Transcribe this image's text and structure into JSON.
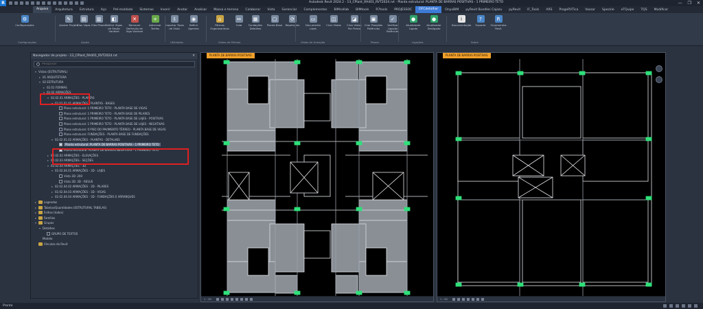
{
  "app": {
    "logo": "R",
    "title": "Autodesk Revit 2024.2 - 13_CPlant_RA401_RVT2024.rvt - Planta estrutural: PLANTA DE BARRAS POSITIVAS - 1 PRIMEIRO TETO"
  },
  "window_controls": [
    "—",
    "❐",
    "✕"
  ],
  "tabs": [
    {
      "label": "Arquivo",
      "state": "active"
    },
    {
      "label": "Arquitetura",
      "state": ""
    },
    {
      "label": "Estrutura",
      "state": ""
    },
    {
      "label": "Aço",
      "state": ""
    },
    {
      "label": "Pré-moldado",
      "state": ""
    },
    {
      "label": "Sistemas",
      "state": ""
    },
    {
      "label": "Inserir",
      "state": ""
    },
    {
      "label": "Anotar",
      "state": ""
    },
    {
      "label": "Analisar",
      "state": ""
    },
    {
      "label": "Massa e terreno",
      "state": ""
    },
    {
      "label": "Colaborar",
      "state": ""
    },
    {
      "label": "Vista",
      "state": ""
    },
    {
      "label": "Gerenciar",
      "state": ""
    },
    {
      "label": "Complementos",
      "state": ""
    },
    {
      "label": "BIMcollab",
      "state": ""
    },
    {
      "label": "BIMtools",
      "state": ""
    },
    {
      "label": "R7tools",
      "state": ""
    },
    {
      "label": "PROJESSOC",
      "state": ""
    },
    {
      "label": "OFCdetalhar",
      "state": "hl"
    },
    {
      "label": "OnyxBIM",
      "state": ""
    },
    {
      "label": "pyRevit Bundles Cajazu",
      "state": ""
    },
    {
      "label": "pyRevit",
      "state": ""
    },
    {
      "label": "IF_Tools",
      "state": ""
    },
    {
      "label": "ARS",
      "state": ""
    },
    {
      "label": "ProgeRVTica",
      "state": ""
    },
    {
      "label": "Vassar",
      "state": ""
    },
    {
      "label": "Speckle",
      "state": ""
    },
    {
      "label": "eTQuipe",
      "state": ""
    },
    {
      "label": "TQS",
      "state": ""
    },
    {
      "label": "Modificar",
      "state": ""
    }
  ],
  "ribbon": {
    "buttons": [
      {
        "label": "Configurações",
        "icon": "gear-icon",
        "glyph": "⚙",
        "color": "#4a86c8"
      },
      {
        "label": "Ajustar Projeto",
        "icon": "adjust-icon",
        "glyph": "✎",
        "color": "#7a8aa0"
      },
      {
        "label": "Elas Vigas",
        "icon": "beam-icon",
        "glyph": "▤",
        "color": "#7a8aa0"
      },
      {
        "label": "Elas Pilares",
        "icon": "column-icon",
        "glyph": "▥",
        "color": "#7a8aa0"
      },
      {
        "label": "Definir Vigas de Seção Variável",
        "icon": "section-icon",
        "glyph": "◧",
        "color": "#7a8aa0"
      },
      {
        "label": "Remover Definição de Viga Variável",
        "icon": "remove-icon",
        "glyph": "✕",
        "color": "#c0504d"
      },
      {
        "label": "Adicionar Tarifas",
        "icon": "add-icon",
        "glyph": "+",
        "color": "#6aaa4a"
      },
      {
        "label": "Importar Tipos de Vista",
        "icon": "import-icon",
        "glyph": "⇩",
        "color": "#7a8aa0"
      },
      {
        "label": "Definir Agentes",
        "icon": "agent-icon",
        "glyph": "◉",
        "color": "#7a8aa0"
      },
      {
        "label": "Fôrmas Organizar/elas",
        "icon": "formwork-icon",
        "glyph": "⌂",
        "color": "#c9a443"
      },
      {
        "label": "Cota",
        "icon": "dimension-icon",
        "glyph": "↔",
        "color": "#7a8aa0"
      },
      {
        "label": "Fundações Detalhes",
        "icon": "foundation-icon",
        "glyph": "▦",
        "color": "#7a8aa0"
      },
      {
        "label": "Planta Base",
        "icon": "floorplan-icon",
        "glyph": "▢",
        "color": "#7a8aa0"
      },
      {
        "label": "Repetições",
        "icon": "repeat-icon",
        "glyph": "⟳",
        "color": "#7a8aa0"
      },
      {
        "label": "Documento Lajes",
        "icon": "document-icon",
        "glyph": "▭",
        "color": "#7a8aa0"
      },
      {
        "label": "Criar Vistas",
        "icon": "create-view-icon",
        "glyph": "◫",
        "color": "#7a8aa0"
      },
      {
        "label": "Criar Vistas Por Ponto",
        "icon": "point-view-icon",
        "glyph": "◪",
        "color": "#7a8aa0"
      },
      {
        "label": "Criar Posições Potências",
        "icon": "positions-icon",
        "glyph": "▣",
        "color": "#7a8aa0"
      },
      {
        "label": "Verificar Ligação Potências",
        "icon": "verify-icon",
        "glyph": "✓",
        "color": "#7a8aa0"
      },
      {
        "label": "Atualizador Ligado",
        "icon": "updater-on-icon",
        "glyph": "●",
        "color": "#2fa36b"
      },
      {
        "label": "Atualizador Desligado",
        "icon": "updater-off-icon",
        "glyph": "●",
        "color": "#2fa36b"
      },
      {
        "label": "Documentação",
        "icon": "info-icon",
        "glyph": "i",
        "color": "#e6e6e6"
      },
      {
        "label": "Suporte",
        "icon": "help-icon",
        "glyph": "?",
        "color": "#4a86c8"
      },
      {
        "label": "Orçamentos Revit",
        "icon": "budget-icon",
        "glyph": "R",
        "color": "#4a86c8"
      }
    ],
    "groups": [
      {
        "label": "Configurações"
      },
      {
        "label": "Ajuste"
      },
      {
        "label": "Utilidades"
      },
      {
        "label": "Vistas de Fôrmas"
      },
      {
        "label": "Vistas de Armação"
      },
      {
        "label": "Passar"
      },
      {
        "label": "Ligações"
      },
      {
        "label": "Sobre"
      }
    ]
  },
  "browser": {
    "title": "Navegador de projeto - 13_CPlant_RA401_RVT2024.rvt",
    "close": "✕",
    "search_placeholder": "Pesquisar",
    "tree": [
      {
        "label": "Vistas (ESTRUTURAL)",
        "tog": "▾",
        "checkbox": "",
        "icon": false,
        "sel": false
      },
      {
        "label": "01 ARQUITETURA",
        "tog": "▸",
        "checkbox": "",
        "icon": false,
        "sel": false
      },
      {
        "label": "02 ESTRUTURA",
        "tog": "▾",
        "checkbox": "",
        "icon": false,
        "sel": false
      },
      {
        "label": "02.01 FORMAS",
        "tog": "▸",
        "checkbox": "",
        "icon": false,
        "sel": false
      },
      {
        "label": "02.02 ARMAÇÕES",
        "tog": "▾",
        "checkbox": "",
        "icon": false,
        "sel": false
      },
      {
        "label": "02.02.01 ARMAÇÕES - PLANTAS",
        "tog": "▾",
        "checkbox": "",
        "icon": false,
        "sel": false
      },
      {
        "label": "02.02.01.01 ARMAÇÕES - PLANTAS - BASES",
        "tog": "▾",
        "checkbox": "",
        "icon": false,
        "sel": false
      },
      {
        "label": "Plano estrutural: 1 PRIMEIRO TETO - PLANTA BASE DE VIGAS",
        "tog": "",
        "checkbox": "off",
        "icon": false,
        "sel": false
      },
      {
        "label": "Plano estrutural: 1 PRIMEIRO TETO - PLANTA BASE DE PILARES",
        "tog": "",
        "checkbox": "off",
        "icon": false,
        "sel": false
      },
      {
        "label": "Plano estrutural: 1 PRIMEIRO TETO - PLANTA BASE DE LAJES - POSITIVAS",
        "tog": "",
        "checkbox": "off",
        "icon": false,
        "sel": false
      },
      {
        "label": "Plano estrutural: 1 PRIMEIRO TETO - PLANTA BASE DE LAJES - NEGATIVAS",
        "tog": "",
        "checkbox": "off",
        "icon": false,
        "sel": false
      },
      {
        "label": "Plano estrutural: 0 PISO DO PAVIMENTO TÉRREO - PLANTA BASE DE VIGAS",
        "tog": "",
        "checkbox": "off",
        "icon": false,
        "sel": false
      },
      {
        "label": "Plano estrutural: FUNDAÇÕES - PLANTA BASE DE FUNDAÇÕES",
        "tog": "",
        "checkbox": "off",
        "icon": false,
        "sel": false
      },
      {
        "label": "02.02.01.02 ARMAÇÕES - PLANTAS - DETALHES",
        "tog": "▾",
        "checkbox": "",
        "icon": false,
        "sel": false
      },
      {
        "label": "Planta estrutural: PLANTA DE BARRAS POSITIVAS - 1 PRIMEIRO TETO",
        "tog": "",
        "checkbox": "on",
        "icon": false,
        "sel": true
      },
      {
        "label": "Planta estrutural: PLANTA DE BARRAS NEGATIVAS - 1 PRIMEIRO TETO",
        "tog": "",
        "checkbox": "on",
        "icon": false,
        "sel": false
      },
      {
        "label": "02.02.02 ARMAÇÕES - ELEVAÇÕES",
        "tog": "▸",
        "checkbox": "",
        "icon": false,
        "sel": false
      },
      {
        "label": "02.02.03 ARMAÇÕES - SEÇÕES",
        "tog": "▸",
        "checkbox": "",
        "icon": false,
        "sel": false
      },
      {
        "label": "02.02.04 ARMAÇÕES - 3D",
        "tog": "▾",
        "checkbox": "",
        "icon": false,
        "sel": false
      },
      {
        "label": "02.02.04.01 ARMAÇÕES - 3D - LAJES",
        "tog": "▾",
        "checkbox": "",
        "icon": false,
        "sel": false
      },
      {
        "label": "Vista 3D: 200",
        "tog": "",
        "checkbox": "off",
        "icon": false,
        "sel": false
      },
      {
        "label": "Vista 3D: 3D - RESUS",
        "tog": "",
        "checkbox": "off",
        "icon": false,
        "sel": false
      },
      {
        "label": "02.02.04.02 ARMAÇÕES - 3D - PILARES",
        "tog": "▸",
        "checkbox": "",
        "icon": false,
        "sel": false
      },
      {
        "label": "02.02.04.03 ARMAÇÕES - 3D - VIGAS",
        "tog": "▸",
        "checkbox": "",
        "icon": false,
        "sel": false
      },
      {
        "label": "02.02.04.04 ARMAÇÕES - 3D - FUNDAÇÕES E ARRANQUES",
        "tog": "▸",
        "checkbox": "",
        "icon": false,
        "sel": false
      },
      {
        "label": "Legendas",
        "tog": "▸",
        "checkbox": "",
        "icon": true,
        "sel": false
      },
      {
        "label": "Tabelas/Quantidades (ESTRUTURAL TABELAS)",
        "tog": "▸",
        "checkbox": "",
        "icon": true,
        "sel": false
      },
      {
        "label": "Folhas (todos)",
        "tog": "▸",
        "checkbox": "",
        "icon": true,
        "sel": false
      },
      {
        "label": "Famílias",
        "tog": "▸",
        "checkbox": "",
        "icon": true,
        "sel": false
      },
      {
        "label": "Grupos",
        "tog": "▾",
        "checkbox": "",
        "icon": true,
        "sel": false
      },
      {
        "label": "Detalhes",
        "tog": "▾",
        "checkbox": "",
        "icon": false,
        "sel": false
      },
      {
        "label": "GRUPO DE TEXTOS",
        "tog": "",
        "checkbox": "off",
        "icon": false,
        "sel": false
      },
      {
        "label": "Modelo",
        "tog": "",
        "checkbox": "",
        "icon": false,
        "sel": false
      },
      {
        "label": "Vínculos do Revit",
        "tog": "",
        "checkbox": "",
        "icon": true,
        "sel": false
      }
    ]
  },
  "view_left": {
    "tab": "PLANTA DE BARRAS POSITIVAS",
    "scale": "1 : 50"
  },
  "view_right": {
    "tab": "PLANTA DE BARRAS POSITIVAS",
    "scale": "1 : 50"
  },
  "status": {
    "text": "Pronto"
  },
  "colors": {
    "accent": "#3d7bd8",
    "view_tab": "#f0a02b",
    "highlight_box": "#e02020",
    "column_marker": "#2fe07a",
    "beam": "#9aa0a8"
  }
}
